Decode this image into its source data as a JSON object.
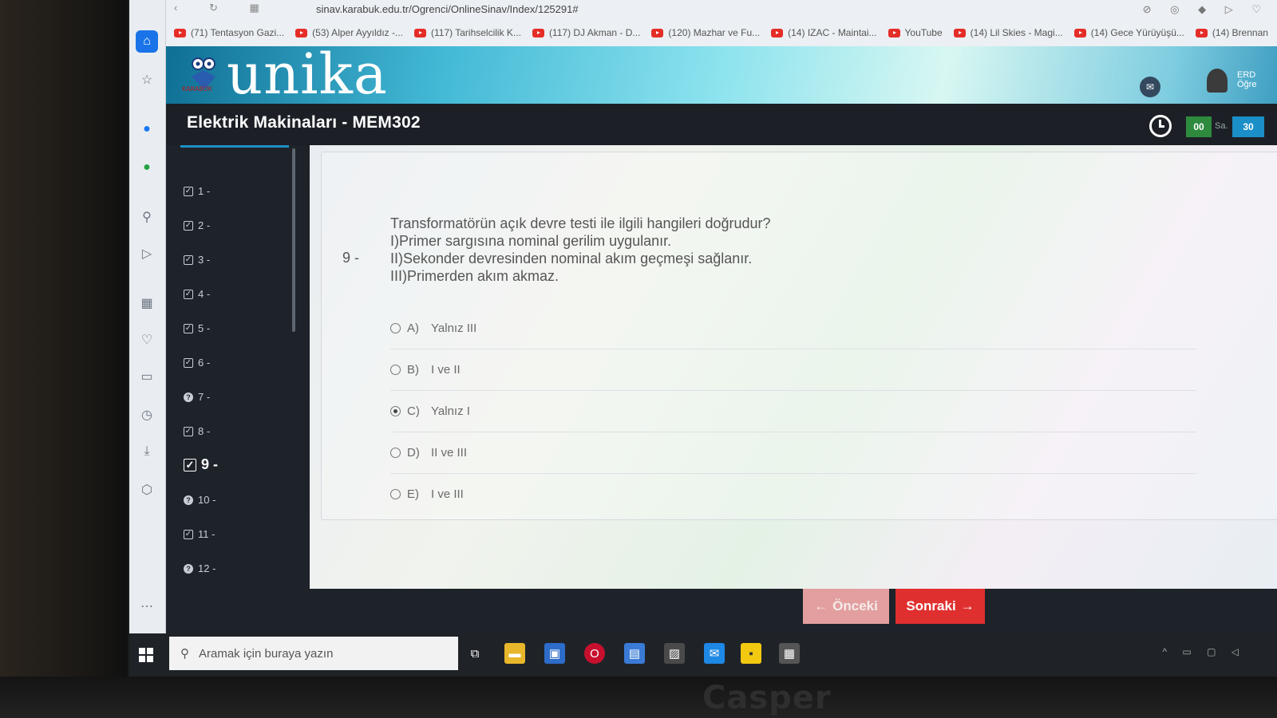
{
  "browser": {
    "url": "sinav.karabuk.edu.tr/Ogrenci/OnlineSinav/Index/125291#",
    "bookmarks": [
      "(71) Tentasyon Gazi...",
      "(53) Alper Ayyıldız -...",
      "(117) Tarihselcilik K...",
      "(117) DJ Akman - D...",
      "(120) Mazhar ve Fu...",
      "(14) IZAC - Maintai...",
      "YouTube",
      "(14) Lil Skies - Magi...",
      "(14) Gece Yürüyüşü...",
      "(14) Brennan"
    ]
  },
  "site": {
    "logo_text": "unika",
    "logo_sub": "KARABÜK",
    "user_short": "ERD",
    "user_role": "Öğre"
  },
  "course": {
    "title": "Elektrik Makinaları - MEM302"
  },
  "timer": {
    "hours": "00",
    "unit": "Sa.",
    "minutes": "30"
  },
  "questions": [
    {
      "label": "1 -",
      "status": "answered"
    },
    {
      "label": "2 -",
      "status": "answered"
    },
    {
      "label": "3 -",
      "status": "answered"
    },
    {
      "label": "4 -",
      "status": "answered"
    },
    {
      "label": "5 -",
      "status": "answered"
    },
    {
      "label": "6 -",
      "status": "answered"
    },
    {
      "label": "7 -",
      "status": "unanswered"
    },
    {
      "label": "8 -",
      "status": "answered"
    },
    {
      "label": "9 -",
      "status": "answered",
      "active": true
    },
    {
      "label": "10 -",
      "status": "unanswered"
    },
    {
      "label": "11 -",
      "status": "answered"
    },
    {
      "label": "12 -",
      "status": "unanswered"
    }
  ],
  "current_question": {
    "number": "9 -",
    "lines": [
      "Transformatörün açık devre testi ile ilgili hangileri doğrudur?",
      "I)Primer sargısına nominal gerilim uygulanır.",
      "II)Sekonder devresinden nominal akım geçmeşi sağlanır.",
      "III)Primerden akım akmaz."
    ],
    "options": [
      {
        "letter": "A)",
        "text": "Yalnız III",
        "selected": false
      },
      {
        "letter": "B)",
        "text": "I ve II",
        "selected": false
      },
      {
        "letter": "C)",
        "text": "Yalnız I",
        "selected": true
      },
      {
        "letter": "D)",
        "text": "II ve III",
        "selected": false
      },
      {
        "letter": "E)",
        "text": "I ve III",
        "selected": false
      }
    ]
  },
  "buttons": {
    "prev": "Önceki",
    "next": "Sonraki"
  },
  "taskbar": {
    "search_placeholder": "Aramak için buraya yazın"
  },
  "device": {
    "brand": "Casper"
  }
}
